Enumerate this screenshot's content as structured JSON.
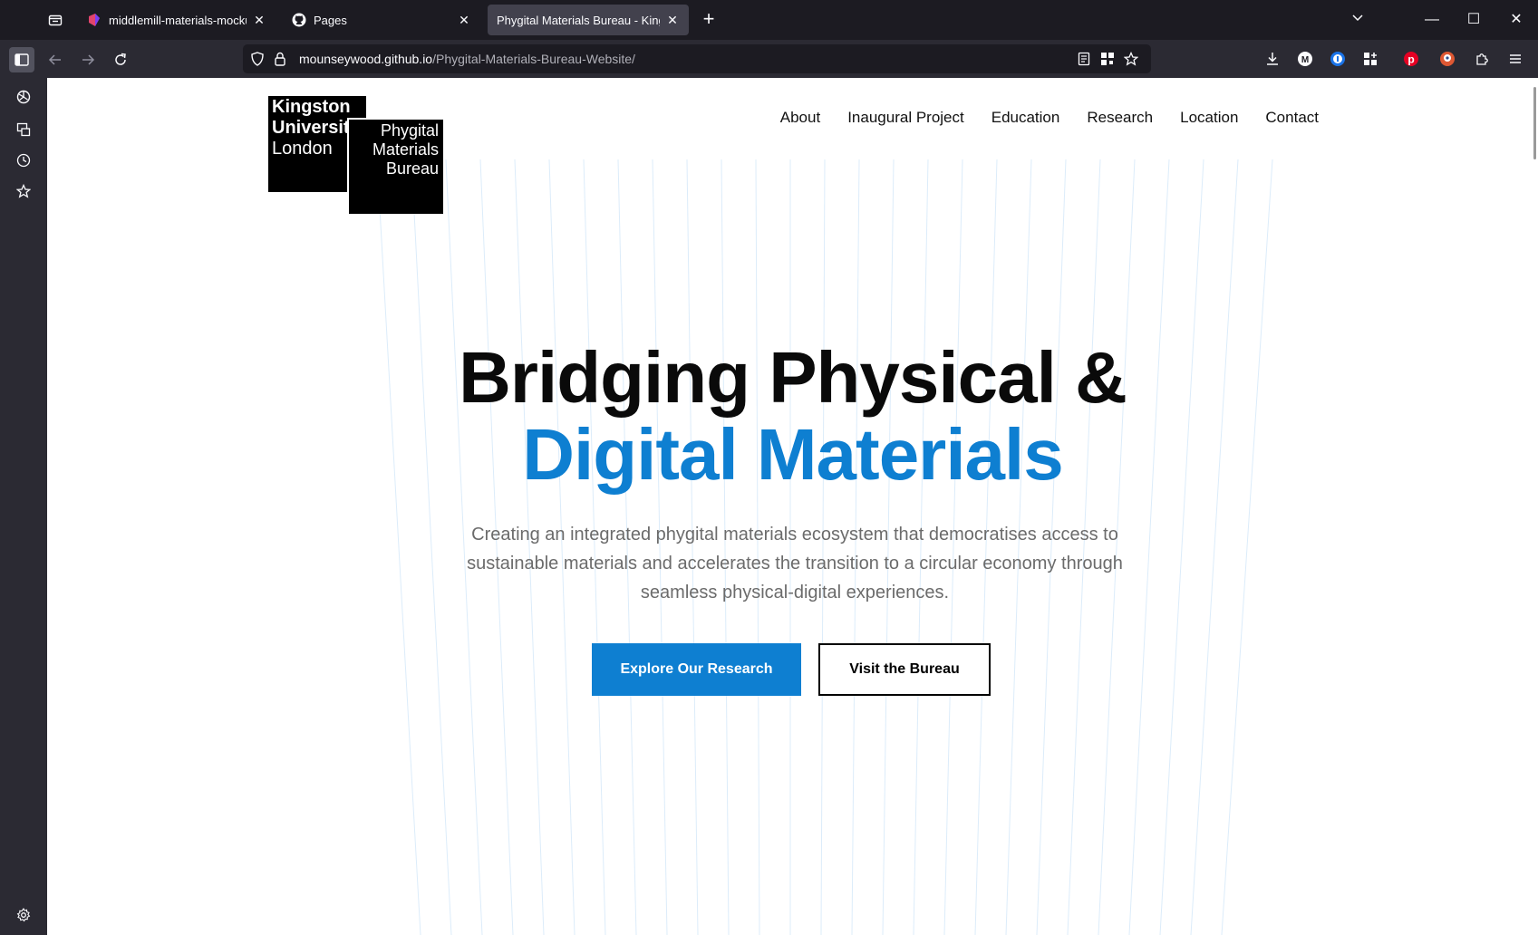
{
  "browser": {
    "tabs": [
      {
        "title": "middlemill-materials-mockup -",
        "active": false
      },
      {
        "title": "Pages",
        "active": false
      },
      {
        "title": "Phygital Materials Bureau - Kingston",
        "active": true
      }
    ],
    "new_tab_label": "+",
    "url": {
      "host": "mounseywood.github.io",
      "path": "/Phygital-Materials-Bureau-Website/"
    },
    "window_controls": {
      "minimize": "—",
      "maximize": "☐",
      "close": "✕"
    }
  },
  "site": {
    "logo_ku": {
      "line1": "Kingston",
      "line2": "University",
      "line3": "London"
    },
    "logo_pmb": {
      "line1": "Phygital",
      "line2": "Materials",
      "line3": "Bureau"
    },
    "nav": [
      "About",
      "Inaugural Project",
      "Education",
      "Research",
      "Location",
      "Contact"
    ],
    "hero": {
      "title_line1": "Bridging Physical &",
      "title_line2": "Digital Materials",
      "subtitle": "Creating an integrated phygital materials ecosystem that democratises access to sustainable materials and accelerates the transition to a circular economy through seamless physical-digital experiences.",
      "primary_button": "Explore Our Research",
      "secondary_button": "Visit the Bureau"
    },
    "colors": {
      "accent": "#0e7fd1",
      "text": "#0a0a0a",
      "muted": "#6b6b6b"
    }
  }
}
